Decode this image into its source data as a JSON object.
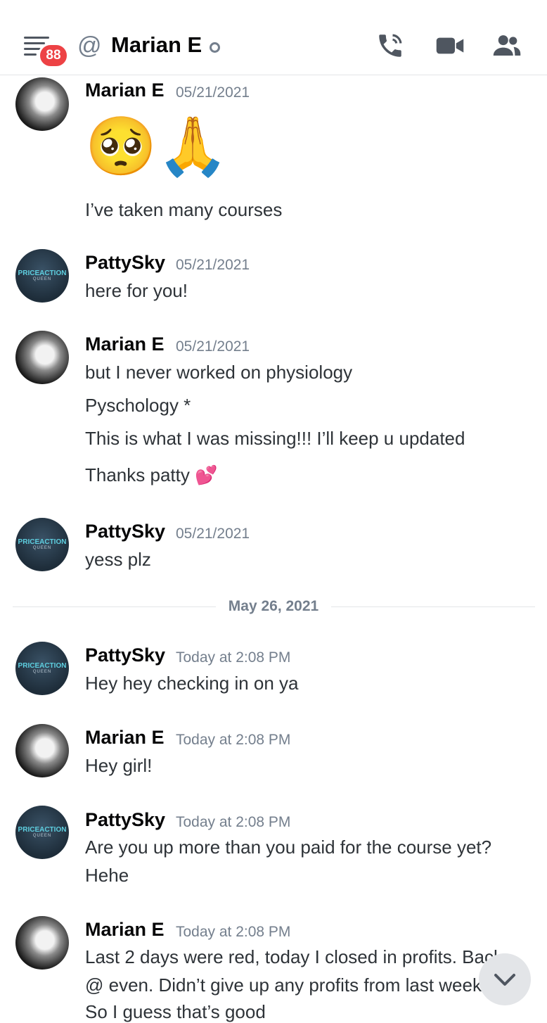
{
  "header": {
    "badge_count": "88",
    "at_symbol": "@",
    "dm_name": "Marian E",
    "icons": [
      "menu-icon",
      "phone-icon",
      "video-icon",
      "members-icon"
    ]
  },
  "divider": {
    "label": "May 26, 2021"
  },
  "messages": [
    {
      "author": "Marian E",
      "timestamp": "05/21/2021",
      "avatar": "marian",
      "emoji": "🥺🙏",
      "lines": [
        "I’ve taken many courses"
      ]
    },
    {
      "author": "PattySky",
      "timestamp": "05/21/2021",
      "avatar": "patty",
      "lines": [
        "here for you!"
      ]
    },
    {
      "author": "Marian E",
      "timestamp": "05/21/2021",
      "avatar": "marian",
      "lines": [
        "but I never worked on physiology",
        "Pyschology *",
        "This is what I was missing!!! I’ll keep u updated",
        "Thanks patty 💕"
      ]
    },
    {
      "author": "PattySky",
      "timestamp": "05/21/2021",
      "avatar": "patty",
      "lines": [
        "yess plz"
      ]
    },
    {
      "author": "PattySky",
      "timestamp": "Today at 2:08 PM",
      "avatar": "patty",
      "lines": [
        "Hey hey checking in on ya"
      ]
    },
    {
      "author": "Marian E",
      "timestamp": "Today at 2:08 PM",
      "avatar": "marian",
      "lines": [
        "Hey girl!"
      ]
    },
    {
      "author": "PattySky",
      "timestamp": "Today at 2:08 PM",
      "avatar": "patty",
      "lines": [
        "Are you up more than you paid for the course yet?",
        "Hehe"
      ]
    },
    {
      "author": "Marian E",
      "timestamp": "Today at 2:08 PM",
      "avatar": "marian",
      "lines": [
        "Last 2 days were red, today I closed in profits. Back",
        "@ even. Didn’t give up any profits from last week.",
        "So I guess that’s good"
      ]
    }
  ],
  "avatar_text": {
    "patty_line1": "PRICEACTION",
    "patty_line2": "QUEEN"
  },
  "colors": {
    "accent_red": "#ed4245",
    "muted": "#747f8d",
    "text": "#2e3338"
  }
}
